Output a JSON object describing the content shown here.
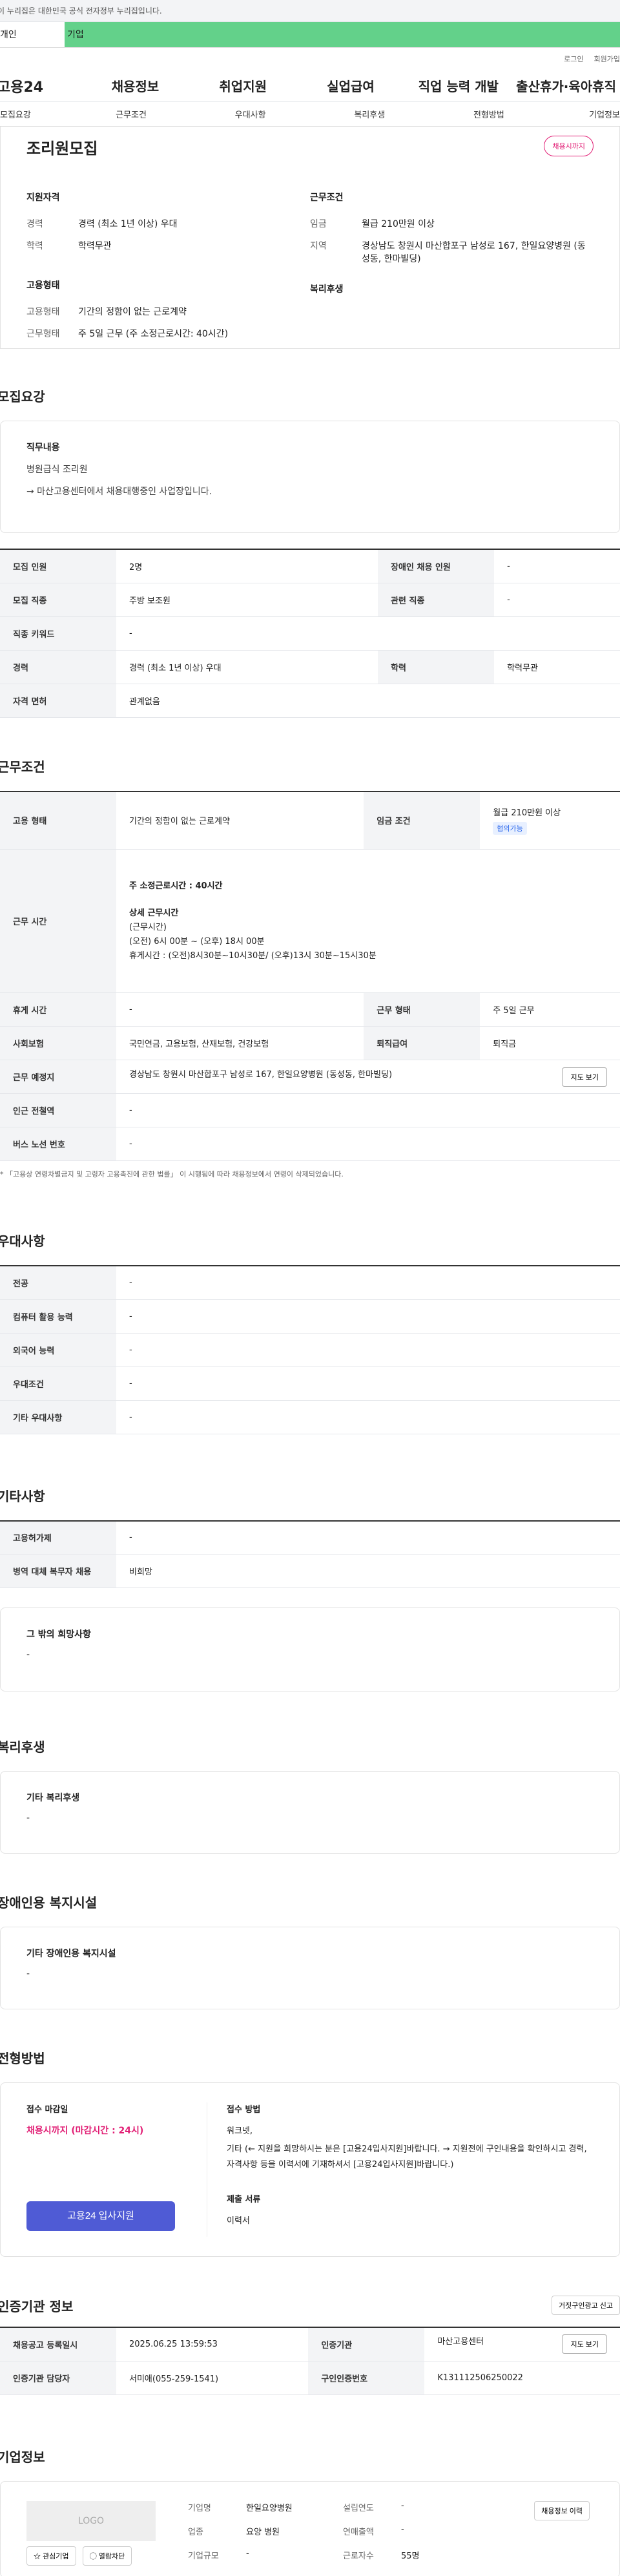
{
  "gov_banner": "이 누리집은 대한민국 공식 전자정부 누리집입니다.",
  "user_tabs": [
    "개인",
    "기업"
  ],
  "util_links": [
    "로그인",
    "회원가입"
  ],
  "site_logo": "고용24",
  "gnb": [
    "채용정보",
    "취업지원",
    "실업급여",
    "직업 능력 개발",
    "출산휴가·육아휴직"
  ],
  "subnav": [
    "모집요강",
    "근무조건",
    "우대사항",
    "복리후생",
    "전형방법",
    "기업정보"
  ],
  "summary": {
    "title": "조리원모집",
    "badge": "채용시까지",
    "qual_title": "지원자격",
    "career_k": "경력",
    "career_v": "경력 (최소 1년 이상) 우대",
    "edu_k": "학력",
    "edu_v": "학력무관",
    "emp_title": "고용형태",
    "emptype_k": "고용형태",
    "emptype_v": "기간의 정함이 없는 근로계약",
    "worktime_k": "근무형태",
    "worktime_v": "주 5일 근무 (주 소정근로시간: 40시간)",
    "cond_title": "근무조건",
    "wage_k": "임금",
    "wage_v": "월급 210만원 이상",
    "area_k": "지역",
    "area_v": "경상남도 창원시 마산합포구 남성로 167, 한일요양병원 (동성동, 한마빌딩)",
    "welfare_title": "복리후생"
  },
  "recruit": {
    "title": "모집요강",
    "job_title": "직무내용",
    "job_line1": "병원급식 조리원",
    "job_line2": "→ 마산고용센터에서 채용대행중인 사업장입니다.",
    "rows": [
      [
        "모집 인원",
        "2명",
        "장애인 채용 인원",
        "-"
      ],
      [
        "모집 직종",
        "주방 보조원",
        "관련 직종",
        "-"
      ],
      [
        "직종 키워드",
        "-"
      ],
      [
        "경력",
        "경력 (최소 1년 이상) 우대",
        "학력",
        "학력무관"
      ],
      [
        "자격 면허",
        "관계없음"
      ]
    ]
  },
  "work": {
    "title": "근무조건",
    "emp_k": "고용 형태",
    "emp_v": "기간의 정함이 없는 근로계약",
    "wage_k": "임금 조건",
    "wage_v": "월급 210만원 이상",
    "wage_tag": "협의가능",
    "time_k": "근무 시간",
    "time_main": "주 소정근로시간 : 40시간",
    "time_detail_title": "상세 근무시간",
    "time_l1": "(근무시간)",
    "time_l2": "(오전) 6시 00분 ~ (오후) 18시 00분",
    "time_l3": "휴게시간 : (오전)8시30분~10시30분/ (오후)13시 30분~15시30분",
    "rest_k": "휴게 시간",
    "rest_v": "-",
    "form_k": "근무 형태",
    "form_v": "주 5일 근무",
    "ins_k": "사회보험",
    "ins_v": "국민연금, 고용보험, 산재보험, 건강보험",
    "ret_k": "퇴직급여",
    "ret_v": "퇴직금",
    "place_k": "근무 예정지",
    "place_v": "경상남도 창원시 마산합포구 남성로 167, 한일요양병원 (동성동, 한마빌딩)",
    "map_btn": "지도 보기",
    "subway_k": "인근 전철역",
    "subway_v": "-",
    "bus_k": "버스 노선 번호",
    "bus_v": "-",
    "note": "* 「고용상 연령차별금지 및 고령자 고용촉진에 관한 법률」 이 시행됨에 따라 채용정보에서 연령이 삭제되었습니다."
  },
  "pref": {
    "title": "우대사항",
    "rows": [
      [
        "전공",
        "-"
      ],
      [
        "컴퓨터 활용 능력",
        "-"
      ],
      [
        "외국어 능력",
        "-"
      ],
      [
        "우대조건",
        "-"
      ],
      [
        "기타 우대사항",
        "-"
      ]
    ]
  },
  "etc": {
    "title": "기타사항",
    "rows": [
      [
        "고용허가제",
        "-"
      ],
      [
        "병역 대체 복무자 채용",
        "비희망"
      ]
    ],
    "other_title": "그 밖의 희망사항",
    "other_v": "-"
  },
  "welfare": {
    "title": "복리후생",
    "sub": "기타 복리후생",
    "v": "-"
  },
  "disabled": {
    "title": "장애인용 복지시설",
    "sub": "기타 장애인용 복지시설",
    "v": "-"
  },
  "selection": {
    "title": "전형방법",
    "deadline_title": "접수 마감일",
    "deadline_v": "채용시까지 (마감시간 : 24시)",
    "apply_btn": "고용24 입사지원",
    "method_title": "접수 방법",
    "method_l1": "워크넷,",
    "method_l2": "기타 (← 지원을 희망하시는 분은 [고용24입사지원]바랍니다. → 지원전에 구인내용을 확인하시고 경력, 자격사항 등을 이력서에 기재하셔서 [고용24입사지원]바랍니다.)",
    "docs_title": "제출 서류",
    "docs_v": "이력서"
  },
  "agency": {
    "title": "인증기관 정보",
    "report_btn": "거짓구인광고 신고",
    "reg_k": "채용공고 등록일시",
    "reg_v": "2025.06.25 13:59:53",
    "org_k": "인증기관",
    "org_v": "마산고용센터",
    "map_btn": "지도 보기",
    "mgr_k": "인증기관 담당자",
    "mgr_v": "서미애(055-259-1541)",
    "auth_k": "구인인증번호",
    "auth_v": "K131112506250022"
  },
  "company": {
    "title": "기업정보",
    "logo": "LOGO",
    "fav_btn": "관심기업",
    "block_btn": "열람차단",
    "name_k": "기업명",
    "name_v": "한일요양병원",
    "year_k": "설립연도",
    "year_v": "-",
    "hist_btn": "채용정보 이력",
    "ind_k": "업종",
    "ind_v": "요양 병원",
    "sales_k": "연매출액",
    "sales_v": "-",
    "size_k": "기업규모",
    "size_v": "-",
    "emp_k": "근로자수",
    "emp_v": "55명"
  }
}
